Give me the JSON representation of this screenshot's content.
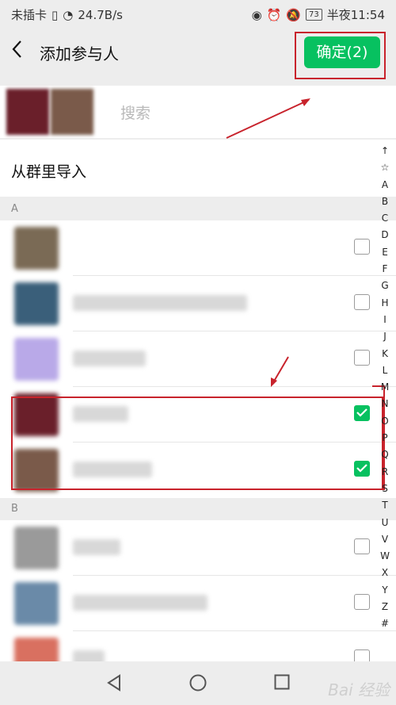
{
  "status_bar": {
    "carrier": "未插卡",
    "net_speed": "24.7B/s",
    "battery": "73",
    "time_label": "半夜11:54"
  },
  "header": {
    "back_icon": "chevron-left-icon",
    "title": "添加参与人",
    "confirm_label": "确定(2)"
  },
  "search": {
    "placeholder": "搜索"
  },
  "import_label": "从群里导入",
  "sections": [
    {
      "letter": "A"
    },
    {
      "letter": "B"
    }
  ],
  "contacts_a": [
    {
      "avatar_color": "#7a6a55",
      "checked": false
    },
    {
      "avatar_color": "#3a5f7a",
      "checked": false
    },
    {
      "avatar_color": "#b9a9e8",
      "checked": false
    },
    {
      "avatar_color": "#6a1f2a",
      "checked": true
    },
    {
      "avatar_color": "#7a5a4a",
      "checked": true
    }
  ],
  "contacts_b": [
    {
      "avatar_color": "#9a9a9a",
      "checked": false
    },
    {
      "avatar_color": "#6a8aa8",
      "checked": false
    },
    {
      "avatar_color": "#d97060",
      "checked": false
    }
  ],
  "index_letters": [
    "↑",
    "☆",
    "A",
    "B",
    "C",
    "D",
    "E",
    "F",
    "G",
    "H",
    "I",
    "J",
    "K",
    "L",
    "M",
    "N",
    "O",
    "P",
    "Q",
    "R",
    "S",
    "T",
    "U",
    "V",
    "W",
    "X",
    "Y",
    "Z",
    "#"
  ],
  "colors": {
    "accent": "#07c160",
    "annotation": "#c8232c"
  },
  "watermark": "Bai 经验"
}
